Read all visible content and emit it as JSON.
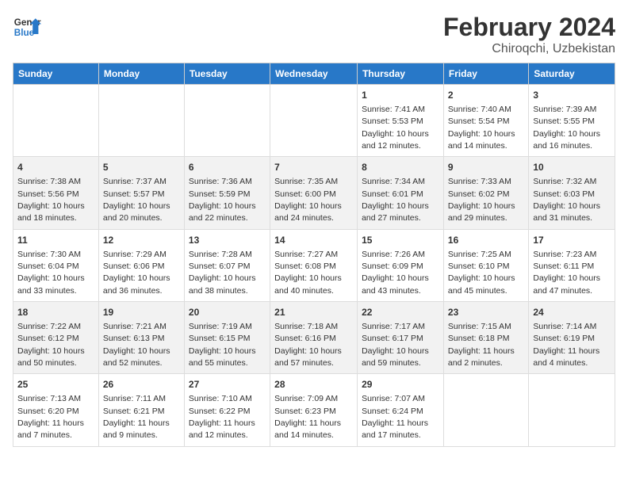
{
  "logo": {
    "line1": "General",
    "line2": "Blue"
  },
  "title": "February 2024",
  "subtitle": "Chiroqchi, Uzbekistan",
  "headers": [
    "Sunday",
    "Monday",
    "Tuesday",
    "Wednesday",
    "Thursday",
    "Friday",
    "Saturday"
  ],
  "weeks": [
    [
      {
        "day": "",
        "info": ""
      },
      {
        "day": "",
        "info": ""
      },
      {
        "day": "",
        "info": ""
      },
      {
        "day": "",
        "info": ""
      },
      {
        "day": "1",
        "info": "Sunrise: 7:41 AM\nSunset: 5:53 PM\nDaylight: 10 hours\nand 12 minutes."
      },
      {
        "day": "2",
        "info": "Sunrise: 7:40 AM\nSunset: 5:54 PM\nDaylight: 10 hours\nand 14 minutes."
      },
      {
        "day": "3",
        "info": "Sunrise: 7:39 AM\nSunset: 5:55 PM\nDaylight: 10 hours\nand 16 minutes."
      }
    ],
    [
      {
        "day": "4",
        "info": "Sunrise: 7:38 AM\nSunset: 5:56 PM\nDaylight: 10 hours\nand 18 minutes."
      },
      {
        "day": "5",
        "info": "Sunrise: 7:37 AM\nSunset: 5:57 PM\nDaylight: 10 hours\nand 20 minutes."
      },
      {
        "day": "6",
        "info": "Sunrise: 7:36 AM\nSunset: 5:59 PM\nDaylight: 10 hours\nand 22 minutes."
      },
      {
        "day": "7",
        "info": "Sunrise: 7:35 AM\nSunset: 6:00 PM\nDaylight: 10 hours\nand 24 minutes."
      },
      {
        "day": "8",
        "info": "Sunrise: 7:34 AM\nSunset: 6:01 PM\nDaylight: 10 hours\nand 27 minutes."
      },
      {
        "day": "9",
        "info": "Sunrise: 7:33 AM\nSunset: 6:02 PM\nDaylight: 10 hours\nand 29 minutes."
      },
      {
        "day": "10",
        "info": "Sunrise: 7:32 AM\nSunset: 6:03 PM\nDaylight: 10 hours\nand 31 minutes."
      }
    ],
    [
      {
        "day": "11",
        "info": "Sunrise: 7:30 AM\nSunset: 6:04 PM\nDaylight: 10 hours\nand 33 minutes."
      },
      {
        "day": "12",
        "info": "Sunrise: 7:29 AM\nSunset: 6:06 PM\nDaylight: 10 hours\nand 36 minutes."
      },
      {
        "day": "13",
        "info": "Sunrise: 7:28 AM\nSunset: 6:07 PM\nDaylight: 10 hours\nand 38 minutes."
      },
      {
        "day": "14",
        "info": "Sunrise: 7:27 AM\nSunset: 6:08 PM\nDaylight: 10 hours\nand 40 minutes."
      },
      {
        "day": "15",
        "info": "Sunrise: 7:26 AM\nSunset: 6:09 PM\nDaylight: 10 hours\nand 43 minutes."
      },
      {
        "day": "16",
        "info": "Sunrise: 7:25 AM\nSunset: 6:10 PM\nDaylight: 10 hours\nand 45 minutes."
      },
      {
        "day": "17",
        "info": "Sunrise: 7:23 AM\nSunset: 6:11 PM\nDaylight: 10 hours\nand 47 minutes."
      }
    ],
    [
      {
        "day": "18",
        "info": "Sunrise: 7:22 AM\nSunset: 6:12 PM\nDaylight: 10 hours\nand 50 minutes."
      },
      {
        "day": "19",
        "info": "Sunrise: 7:21 AM\nSunset: 6:13 PM\nDaylight: 10 hours\nand 52 minutes."
      },
      {
        "day": "20",
        "info": "Sunrise: 7:19 AM\nSunset: 6:15 PM\nDaylight: 10 hours\nand 55 minutes."
      },
      {
        "day": "21",
        "info": "Sunrise: 7:18 AM\nSunset: 6:16 PM\nDaylight: 10 hours\nand 57 minutes."
      },
      {
        "day": "22",
        "info": "Sunrise: 7:17 AM\nSunset: 6:17 PM\nDaylight: 10 hours\nand 59 minutes."
      },
      {
        "day": "23",
        "info": "Sunrise: 7:15 AM\nSunset: 6:18 PM\nDaylight: 11 hours\nand 2 minutes."
      },
      {
        "day": "24",
        "info": "Sunrise: 7:14 AM\nSunset: 6:19 PM\nDaylight: 11 hours\nand 4 minutes."
      }
    ],
    [
      {
        "day": "25",
        "info": "Sunrise: 7:13 AM\nSunset: 6:20 PM\nDaylight: 11 hours\nand 7 minutes."
      },
      {
        "day": "26",
        "info": "Sunrise: 7:11 AM\nSunset: 6:21 PM\nDaylight: 11 hours\nand 9 minutes."
      },
      {
        "day": "27",
        "info": "Sunrise: 7:10 AM\nSunset: 6:22 PM\nDaylight: 11 hours\nand 12 minutes."
      },
      {
        "day": "28",
        "info": "Sunrise: 7:09 AM\nSunset: 6:23 PM\nDaylight: 11 hours\nand 14 minutes."
      },
      {
        "day": "29",
        "info": "Sunrise: 7:07 AM\nSunset: 6:24 PM\nDaylight: 11 hours\nand 17 minutes."
      },
      {
        "day": "",
        "info": ""
      },
      {
        "day": "",
        "info": ""
      }
    ]
  ]
}
